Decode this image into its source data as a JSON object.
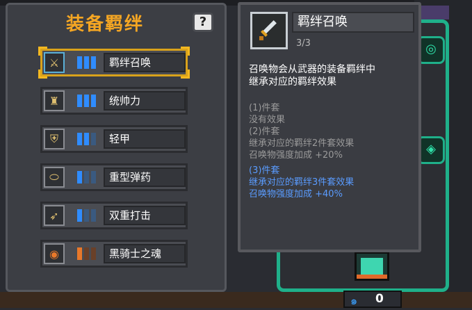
{
  "panel": {
    "title": "装备羁绊",
    "help_label": "?"
  },
  "bonds": [
    {
      "name": "羁绊召唤",
      "icon": "sword-icon",
      "active_bars": 3,
      "color": "blue",
      "selected": true
    },
    {
      "name": "统帅力",
      "icon": "torch-icon",
      "active_bars": 3,
      "color": "blue",
      "selected": false
    },
    {
      "name": "轻甲",
      "icon": "armor-icon",
      "active_bars": 2,
      "color": "blue",
      "selected": false
    },
    {
      "name": "重型弹药",
      "icon": "ammo-icon",
      "active_bars": 1,
      "color": "blue",
      "selected": false
    },
    {
      "name": "双重打击",
      "icon": "bow-icon",
      "active_bars": 1,
      "color": "blue",
      "selected": false
    },
    {
      "name": "黑骑士之魂",
      "icon": "soul-icon",
      "active_bars": 1,
      "color": "orange",
      "selected": false
    }
  ],
  "tooltip": {
    "icon": "sword-icon",
    "name": "羁绊召唤",
    "count": "3/3",
    "desc_line1": "召唤物会从武器的装备羁绊中",
    "desc_line2": "继承对应的羁绊效果",
    "tier1_title": "(1)件套",
    "tier1_effect": "没有效果",
    "tier2_title": "(2)件套",
    "tier2_effect1": "继承对应的羁绊2件套效果",
    "tier2_effect2": "召唤物强度加成 +20%",
    "tier3_title": "(3)件套",
    "tier3_effect1": "继承对应的羁绊3件套效果",
    "tier3_effect2": "召唤物强度加成 +40%"
  },
  "currency": {
    "icon": "swirl-icon",
    "value": "0"
  },
  "colors": {
    "title": "#f5a623",
    "active_tier": "#5a9cff",
    "inactive_tier": "#9a9a9a",
    "teal": "#1fb08a"
  }
}
